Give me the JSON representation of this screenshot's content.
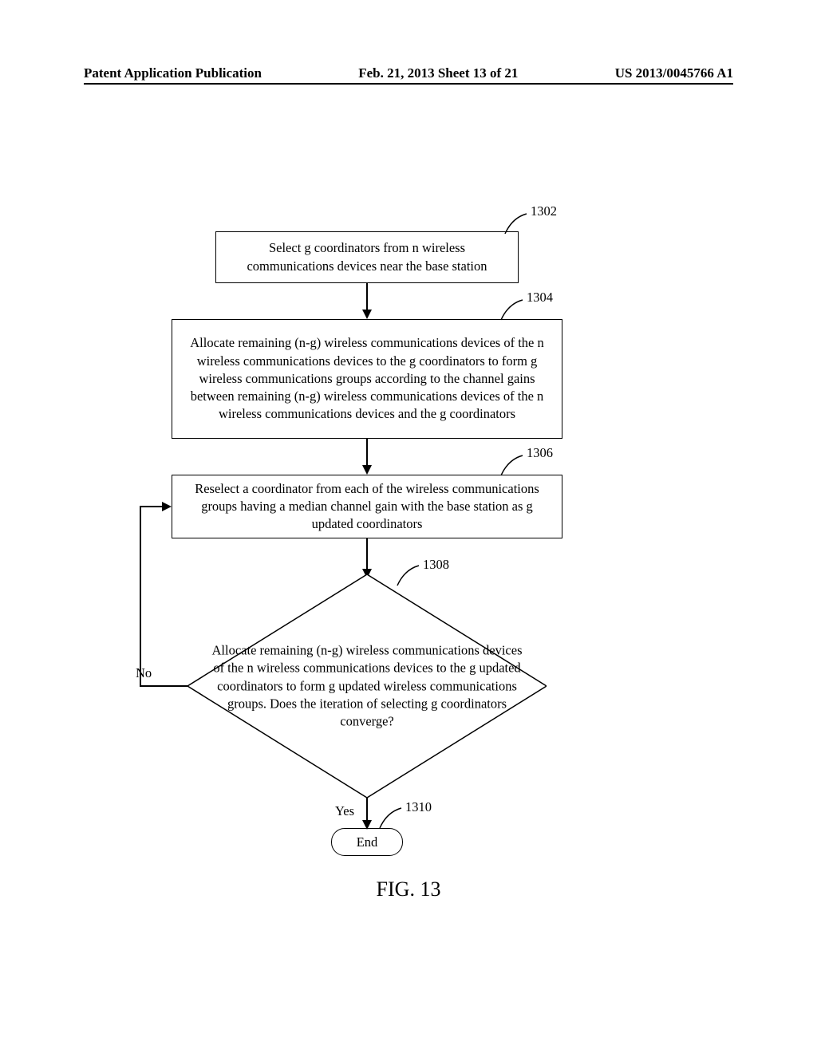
{
  "header": {
    "left": "Patent Application Publication",
    "center": "Feb. 21, 2013  Sheet 13 of 21",
    "right": "US 2013/0045766 A1"
  },
  "flowchart": {
    "box1302": {
      "ref": "1302",
      "text": "Select g coordinators from n wireless communications devices near the base station"
    },
    "box1304": {
      "ref": "1304",
      "text": "Allocate remaining (n-g) wireless communications devices of the n wireless communications devices to the g coordinators to form g wireless communications groups according to the channel gains between remaining (n-g) wireless communications devices of the n wireless communications devices and the g coordinators"
    },
    "box1306": {
      "ref": "1306",
      "text": "Reselect a coordinator from each of the wireless communications groups having a median channel gain with the base station  as g updated coordinators"
    },
    "diamond1308": {
      "ref": "1308",
      "text": "Allocate remaining (n-g) wireless communications devices of the n wireless communications devices to the g updated coordinators to form g updated wireless communications groups. Does the iteration of selecting g coordinators converge?"
    },
    "end1310": {
      "ref": "1310",
      "text": "End"
    },
    "labels": {
      "no": "No",
      "yes": "Yes"
    },
    "figureLabel": "FIG. 13"
  },
  "chart_data": {
    "type": "flowchart",
    "nodes": [
      {
        "id": "1302",
        "shape": "rectangle",
        "text": "Select g coordinators from n wireless communications devices near the base station"
      },
      {
        "id": "1304",
        "shape": "rectangle",
        "text": "Allocate remaining (n-g) wireless communications devices of the n wireless communications devices to the g coordinators to form g wireless communications groups according to the channel gains between remaining (n-g) wireless communications devices of the n wireless communications devices and the g coordinators"
      },
      {
        "id": "1306",
        "shape": "rectangle",
        "text": "Reselect a coordinator from each of the wireless communications groups having a median channel gain with the base station as g updated coordinators"
      },
      {
        "id": "1308",
        "shape": "diamond",
        "text": "Allocate remaining (n-g) wireless communications devices of the n wireless communications devices to the g updated coordinators to form g updated wireless communications groups. Does the iteration of selecting g coordinators converge?"
      },
      {
        "id": "1310",
        "shape": "terminator",
        "text": "End"
      }
    ],
    "edges": [
      {
        "from": "1302",
        "to": "1304"
      },
      {
        "from": "1304",
        "to": "1306"
      },
      {
        "from": "1306",
        "to": "1308"
      },
      {
        "from": "1308",
        "to": "1310",
        "label": "Yes"
      },
      {
        "from": "1308",
        "to": "1306",
        "label": "No"
      }
    ],
    "title": "FIG. 13"
  }
}
